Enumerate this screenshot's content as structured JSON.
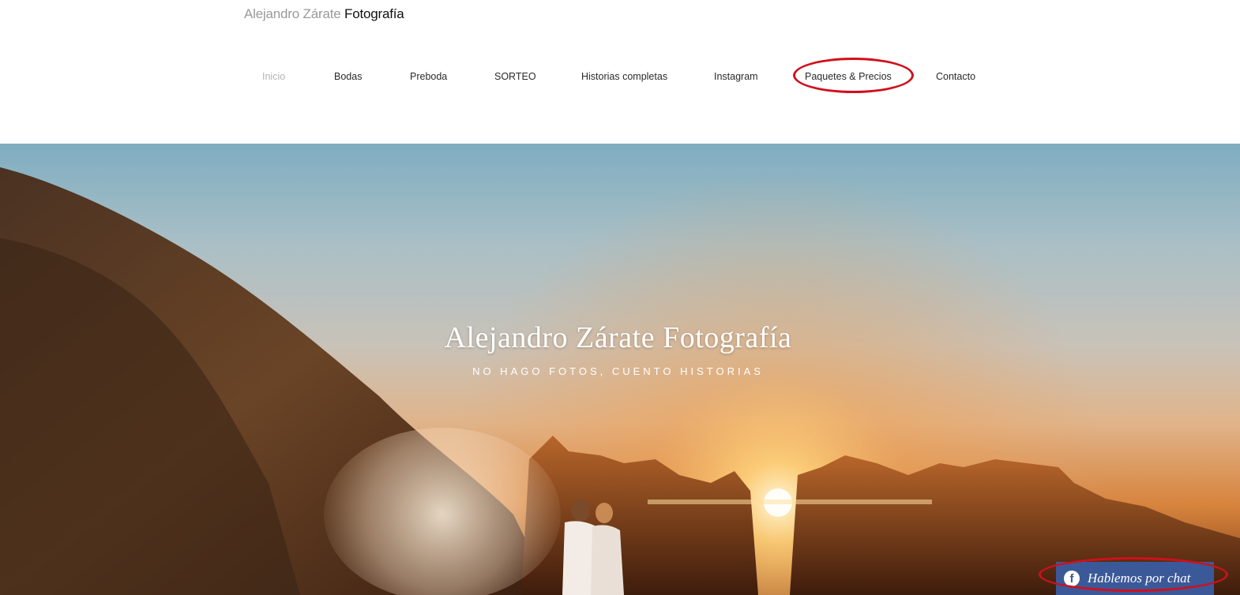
{
  "header": {
    "logo_light": "Alejandro Zárate",
    "logo_dark": "Fotografía"
  },
  "nav": {
    "items": [
      {
        "label": "Inicio",
        "active": true
      },
      {
        "label": "Bodas"
      },
      {
        "label": "Preboda"
      },
      {
        "label": "SORTEO"
      },
      {
        "label": "Historias completas"
      },
      {
        "label": "Instagram"
      },
      {
        "label": "Paquetes & Precios",
        "highlighted": true
      },
      {
        "label": "Contacto"
      }
    ]
  },
  "hero": {
    "title": "Alejandro Zárate Fotografía",
    "subtitle": "NO HAGO FOTOS, CUENTO HISTORIAS"
  },
  "chat": {
    "label": "Hablemos por chat",
    "icon": "facebook-icon",
    "color": "#3b5998"
  },
  "colors": {
    "annotation": "#d0101d",
    "nav_active": "#b5b5b5",
    "nav_text": "#2a2a2a"
  }
}
